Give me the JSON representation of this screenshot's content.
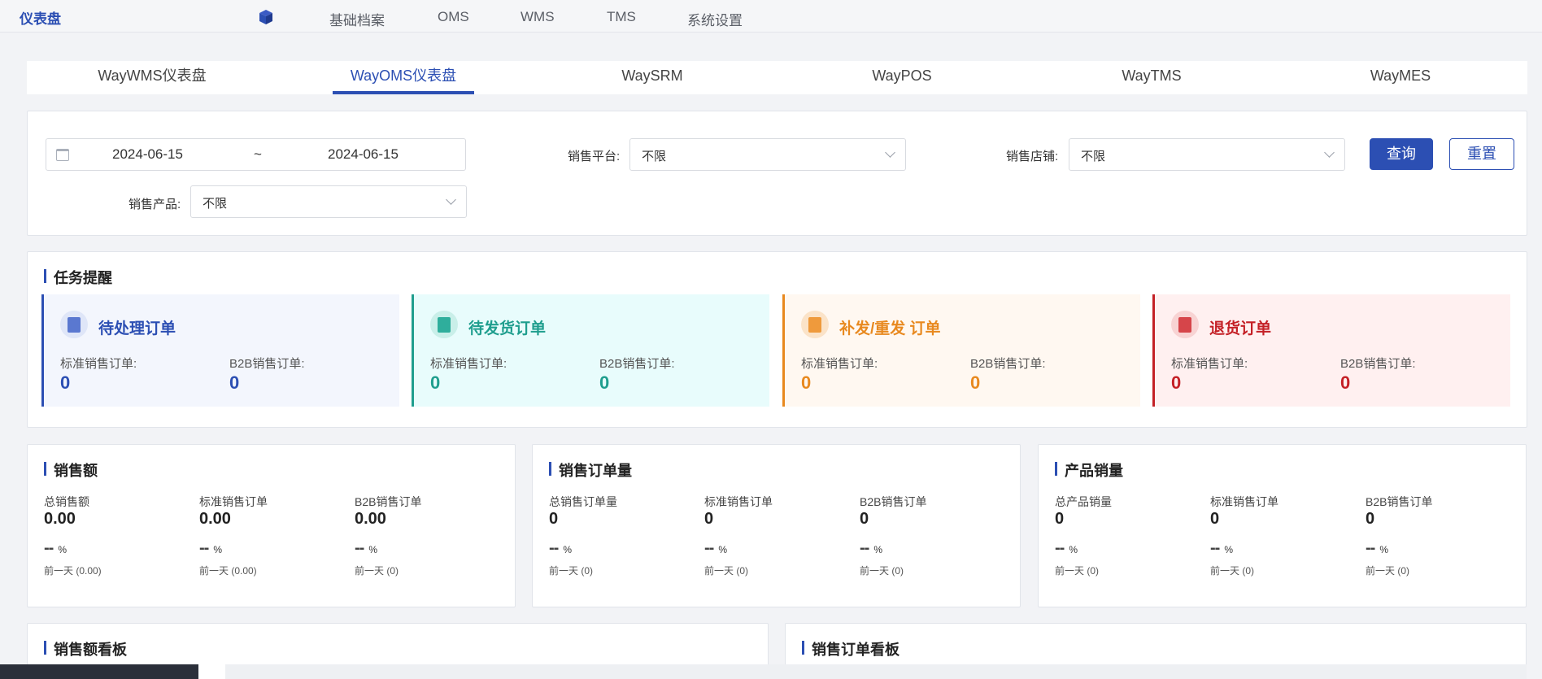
{
  "topbar": {
    "brand": "仪表盘",
    "menu": [
      "基础档案",
      "OMS",
      "WMS",
      "TMS",
      "系统设置"
    ]
  },
  "tabs": [
    {
      "label": "WayWMS仪表盘",
      "active": false
    },
    {
      "label": "WayOMS仪表盘",
      "active": true
    },
    {
      "label": "WaySRM",
      "active": false
    },
    {
      "label": "WayPOS",
      "active": false
    },
    {
      "label": "WayTMS",
      "active": false
    },
    {
      "label": "WayMES",
      "active": false
    }
  ],
  "filters": {
    "date_start": "2024-06-15",
    "date_sep": "~",
    "date_end": "2024-06-15",
    "platform_label": "销售平台:",
    "platform_value": "不限",
    "store_label": "销售店铺:",
    "store_value": "不限",
    "product_label": "销售产品:",
    "product_value": "不限",
    "query_button": "查询",
    "reset_button": "重置"
  },
  "tasks": {
    "title": "任务提醒",
    "cards": [
      {
        "name": "待处理订单",
        "std_label": "标准销售订单:",
        "std_value": "0",
        "b2b_label": "B2B销售订单:",
        "b2b_value": "0",
        "color": "#2c4fb3",
        "bg": "#f3f6fd",
        "icon": "clipboard-icon"
      },
      {
        "name": "待发货订单",
        "std_label": "标准销售订单:",
        "std_value": "0",
        "b2b_label": "B2B销售订单:",
        "b2b_value": "0",
        "color": "#1f9e8e",
        "bg": "#e8fcfc",
        "icon": "truck-icon"
      },
      {
        "name": "补发/重发 订单",
        "std_label": "标准销售订单:",
        "std_value": "0",
        "b2b_label": "B2B销售订单:",
        "b2b_value": "0",
        "color": "#e8891f",
        "bg": "#fff8f1",
        "icon": "box-icon"
      },
      {
        "name": "退货订单",
        "std_label": "标准销售订单:",
        "std_value": "0",
        "b2b_label": "B2B销售订单:",
        "b2b_value": "0",
        "color": "#c42026",
        "bg": "#fff0f0",
        "icon": "return-icon"
      }
    ]
  },
  "metrics": [
    {
      "title": "销售额",
      "cols": [
        {
          "label": "总销售额",
          "value": "0.00",
          "dash": "--",
          "unit": "%",
          "prev": "前一天 (0.00)"
        },
        {
          "label": "标准销售订单",
          "value": "0.00",
          "dash": "--",
          "unit": "%",
          "prev": "前一天 (0.00)"
        },
        {
          "label": "B2B销售订单",
          "value": "0.00",
          "dash": "--",
          "unit": "%",
          "prev": "前一天 (0)"
        }
      ]
    },
    {
      "title": "销售订单量",
      "cols": [
        {
          "label": "总销售订单量",
          "value": "0",
          "dash": "--",
          "unit": "%",
          "prev": "前一天 (0)"
        },
        {
          "label": "标准销售订单",
          "value": "0",
          "dash": "--",
          "unit": "%",
          "prev": "前一天 (0)"
        },
        {
          "label": "B2B销售订单",
          "value": "0",
          "dash": "--",
          "unit": "%",
          "prev": "前一天 (0)"
        }
      ]
    },
    {
      "title": "产品销量",
      "cols": [
        {
          "label": "总产品销量",
          "value": "0",
          "dash": "--",
          "unit": "%",
          "prev": "前一天 (0)"
        },
        {
          "label": "标准销售订单",
          "value": "0",
          "dash": "--",
          "unit": "%",
          "prev": "前一天 (0)"
        },
        {
          "label": "B2B销售订单",
          "value": "0",
          "dash": "--",
          "unit": "%",
          "prev": "前一天 (0)"
        }
      ]
    }
  ],
  "boards": {
    "sales_amount": "销售额看板",
    "sales_orders": "销售订单看板"
  }
}
